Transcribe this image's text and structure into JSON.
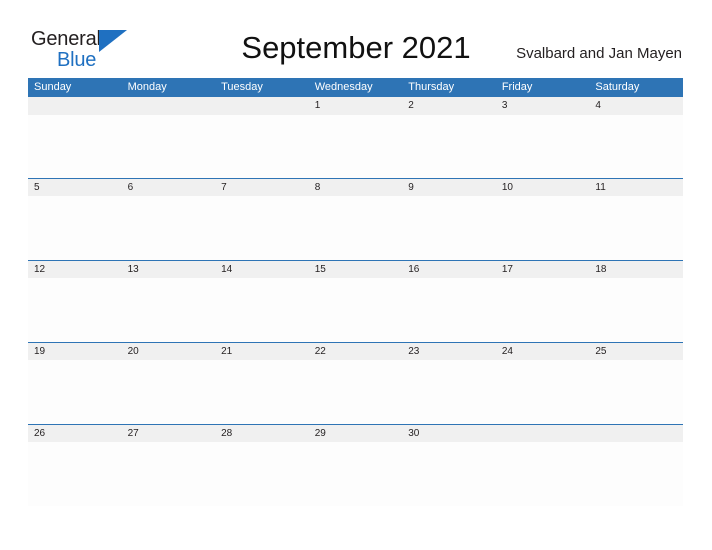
{
  "header": {
    "logo": {
      "primary_text": "General",
      "secondary_text": "Blue",
      "primary_color": "#231f20",
      "secondary_color": "#1f70c1",
      "flag_icon": "triangle-flag-icon"
    },
    "title": "September 2021",
    "region": "Svalbard and Jan Mayen"
  },
  "calendar": {
    "accent_color": "#2e74b5",
    "date_band_color": "#f0f0f0",
    "weekdays": [
      "Sunday",
      "Monday",
      "Tuesday",
      "Wednesday",
      "Thursday",
      "Friday",
      "Saturday"
    ],
    "weeks": [
      {
        "dates": [
          "",
          "",
          "",
          "1",
          "2",
          "3",
          "4"
        ]
      },
      {
        "dates": [
          "5",
          "6",
          "7",
          "8",
          "9",
          "10",
          "11"
        ]
      },
      {
        "dates": [
          "12",
          "13",
          "14",
          "15",
          "16",
          "17",
          "18"
        ]
      },
      {
        "dates": [
          "19",
          "20",
          "21",
          "22",
          "23",
          "24",
          "25"
        ]
      },
      {
        "dates": [
          "26",
          "27",
          "28",
          "29",
          "30",
          "",
          ""
        ]
      }
    ]
  }
}
